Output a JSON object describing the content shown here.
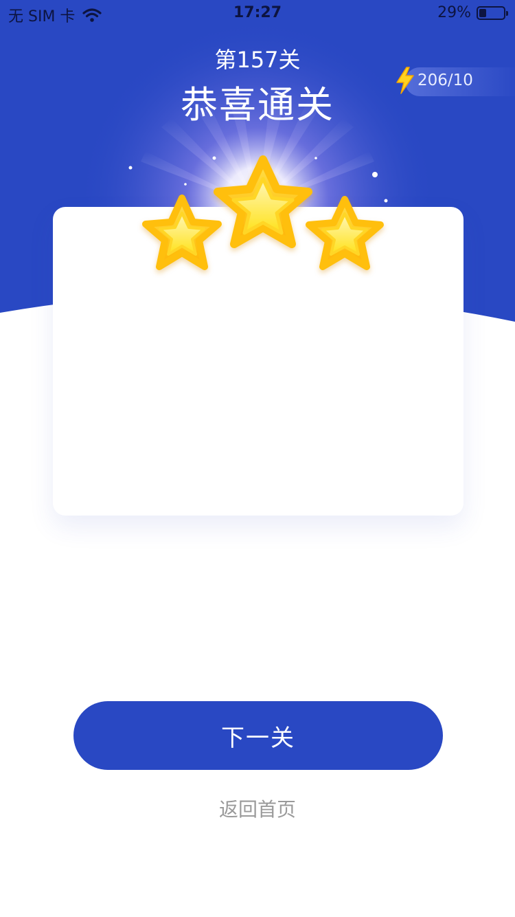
{
  "status_bar": {
    "carrier": "无 SIM 卡",
    "time": "17:27",
    "battery_percent": "29%",
    "battery_level": 0.29,
    "wifi_icon": "wifi-icon"
  },
  "header": {
    "level_label": "第157关",
    "title": "恭喜通关",
    "energy": {
      "icon": "lightning-icon",
      "value": "206/10"
    }
  },
  "result": {
    "stars_earned": 3,
    "stars_total": 3
  },
  "actions": {
    "next_label": "下一关",
    "home_label": "返回首页"
  },
  "colors": {
    "primary_blue": "#2948c3",
    "star_gold": "#ffc41a",
    "text_gray": "#9a9a9a"
  }
}
